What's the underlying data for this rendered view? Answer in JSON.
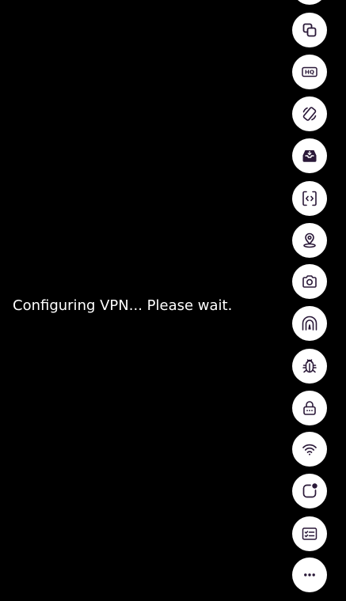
{
  "status": {
    "message": "Configuring VPN... Please wait."
  },
  "theme": {
    "background": "#000000",
    "text": "#ffffff",
    "button_background": "#ffffff",
    "icon_color": "#2a1838"
  },
  "toolbar": {
    "buttons": [
      {
        "id": "top-partial",
        "icon": "partial-button"
      },
      {
        "id": "copy",
        "icon": "copy-icon"
      },
      {
        "id": "hq",
        "icon": "hq-icon",
        "label": "HQ"
      },
      {
        "id": "rotate",
        "icon": "rotate-device-icon"
      },
      {
        "id": "inbox",
        "icon": "inbox-tray-icon"
      },
      {
        "id": "code",
        "icon": "code-screen-icon"
      },
      {
        "id": "location",
        "icon": "map-pin-icon"
      },
      {
        "id": "camera",
        "icon": "camera-icon"
      },
      {
        "id": "tunnel",
        "icon": "tunnel-icon"
      },
      {
        "id": "debug",
        "icon": "bug-icon"
      },
      {
        "id": "lock",
        "icon": "lock-icon"
      },
      {
        "id": "wifi",
        "icon": "wifi-icon"
      },
      {
        "id": "notification",
        "icon": "notification-dot-icon"
      },
      {
        "id": "checklist",
        "icon": "checklist-icon"
      },
      {
        "id": "more",
        "icon": "more-dots-icon"
      }
    ]
  }
}
